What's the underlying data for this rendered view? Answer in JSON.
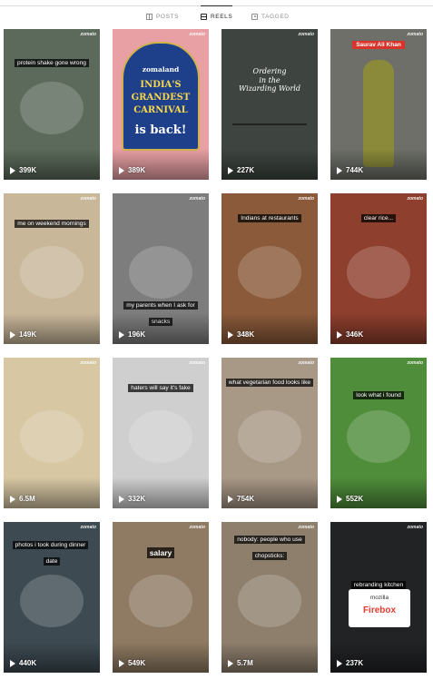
{
  "tabs": [
    {
      "label": "POSTS",
      "active": false,
      "icon": "grid-icon"
    },
    {
      "label": "REELS",
      "active": true,
      "icon": "reels-icon"
    },
    {
      "label": "TAGGED",
      "active": false,
      "icon": "tagged-icon"
    }
  ],
  "brand": "zomato",
  "reels": [
    {
      "views": "399K",
      "caption": "protein shake gone wrong",
      "bg": "#5b6a5a"
    },
    {
      "views": "389K",
      "caption": "",
      "bg": "#e8a0a4",
      "poster": {
        "logo": "zomaland",
        "line1": "INDIA'S",
        "line2": "GRANDEST",
        "line3": "CARNIVAL",
        "line4": "is back!"
      }
    },
    {
      "views": "227K",
      "caption": "",
      "bg": "#3e4540",
      "sign": {
        "line1": "Ordering",
        "line2": "in the",
        "line3": "Wizarding World"
      }
    },
    {
      "views": "744K",
      "caption": "",
      "bg": "#6d6f68",
      "name_tag": "Saurav Ali Khan"
    },
    {
      "views": "149K",
      "caption": "me on weekend mornings",
      "bg": "#c9b79a"
    },
    {
      "views": "196K",
      "caption": "my parents when I ask for snacks",
      "bg": "#7d7d7d"
    },
    {
      "views": "348K",
      "caption": "Indians at restaurants",
      "bg": "#8a5a3a"
    },
    {
      "views": "346K",
      "caption": "clear rice...",
      "bg": "#8e3f2e"
    },
    {
      "views": "6.5M",
      "caption": "",
      "bg": "#d7c7a3"
    },
    {
      "views": "332K",
      "caption": "haters will say it's fake",
      "bg": "#cfcfcf"
    },
    {
      "views": "754K",
      "caption": "what vegetarian food looks like",
      "bg": "#a89886"
    },
    {
      "views": "552K",
      "caption": "look what i found",
      "bg": "#4f8d3a"
    },
    {
      "views": "440K",
      "caption": "photos i took during dinner date",
      "bg": "#3d4a52"
    },
    {
      "views": "549K",
      "caption": "salary",
      "bg": "#8f7b63"
    },
    {
      "views": "5.7M",
      "caption": "nobody: people who use chopsticks:",
      "bg": "#8e7f6d"
    },
    {
      "views": "237K",
      "caption": "rebranding kitchen",
      "bg": "#222325",
      "firebox": {
        "title": "mozilla",
        "name": "Firebox"
      }
    }
  ]
}
